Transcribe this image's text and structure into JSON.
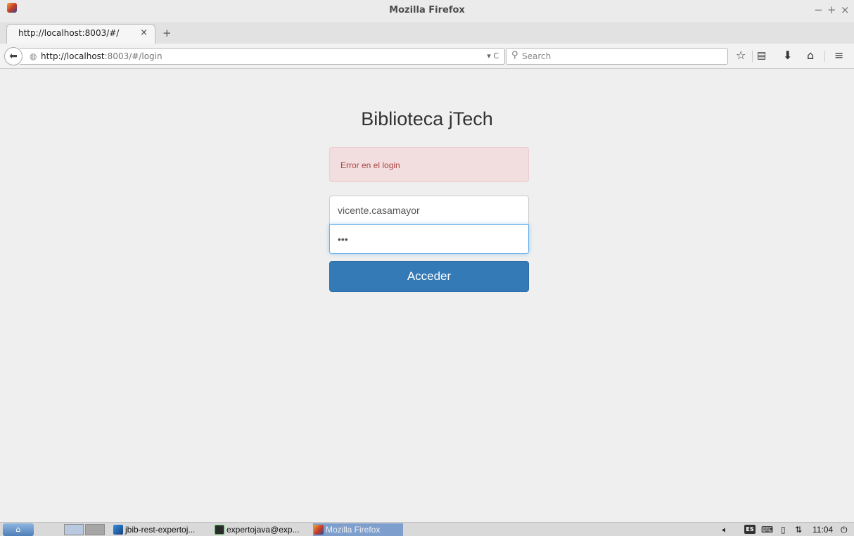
{
  "window": {
    "title": "Mozilla Firefox",
    "controls": {
      "minimize": "−",
      "maximize": "+",
      "close": "×"
    }
  },
  "tabs": [
    {
      "title": "http://localhost:8003/#/",
      "close": "×"
    }
  ],
  "new_tab_label": "+",
  "navbar": {
    "url_host": "http://localhost",
    "url_rest": ":8003/#/login",
    "url_full": "http://localhost:8003/#/login",
    "url_controls": "▾ C",
    "search_placeholder": "Search",
    "icons": [
      "back-icon",
      "globe-icon",
      "dropdown-icon",
      "reload-icon",
      "search-icon",
      "bookmark-star-icon",
      "reading-list-icon",
      "download-icon",
      "home-icon",
      "menu-icon"
    ]
  },
  "page": {
    "title": "Biblioteca jTech",
    "alert": "Error en el login",
    "username": "vicente.casamayor",
    "password": "•••",
    "submit_label": "Acceder",
    "colors": {
      "alert_bg": "#f2dede",
      "alert_text": "#a94442",
      "button_bg": "#337ab7",
      "focus_border": "#66afe9"
    }
  },
  "taskbar": {
    "tasks": [
      {
        "label": "jbib-rest-expertoj...",
        "icon": "intellij-icon"
      },
      {
        "label": "expertojava@exp...",
        "icon": "terminal-icon"
      },
      {
        "label": "Mozilla Firefox",
        "icon": "firefox-icon",
        "active": true
      }
    ],
    "tray_lang": "ES",
    "clock": "11:04",
    "tray_icons": [
      "volume-icon",
      "keyboard-layout-icon",
      "keyboard-icon",
      "battery-icon",
      "network-icon",
      "power-icon"
    ]
  }
}
